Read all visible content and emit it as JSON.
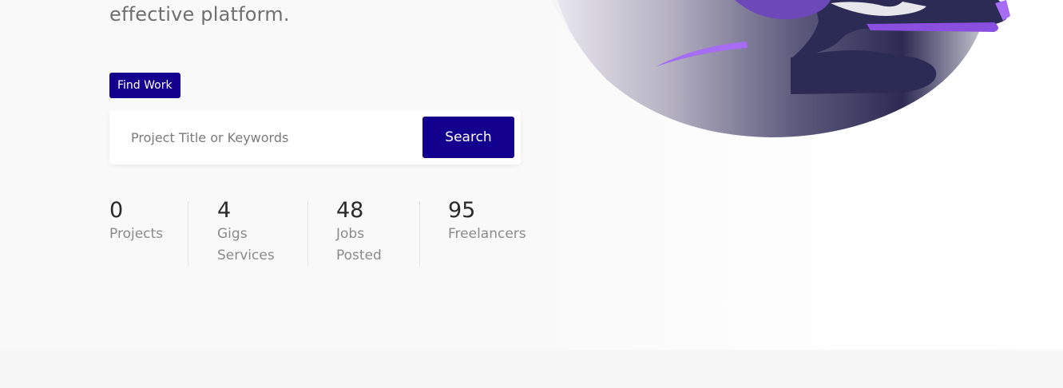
{
  "hero": {
    "tagline": "effective platform.",
    "find_work_label": "Find Work",
    "search": {
      "placeholder": "Project Title or Keywords",
      "button_label": "Search"
    },
    "stats": [
      {
        "value": "0",
        "label": "Projects"
      },
      {
        "value": "4",
        "label": "Gigs\nServices"
      },
      {
        "value": "48",
        "label": "Jobs\nPosted"
      },
      {
        "value": "95",
        "label": "Freelancers"
      }
    ]
  },
  "colors": {
    "accent": "#13008f",
    "background": "#f9f9f9",
    "purple": "#a66cf4",
    "navy": "#2b2b55"
  },
  "icons": {
    "illustration": "hero-freelancer-illustration"
  }
}
